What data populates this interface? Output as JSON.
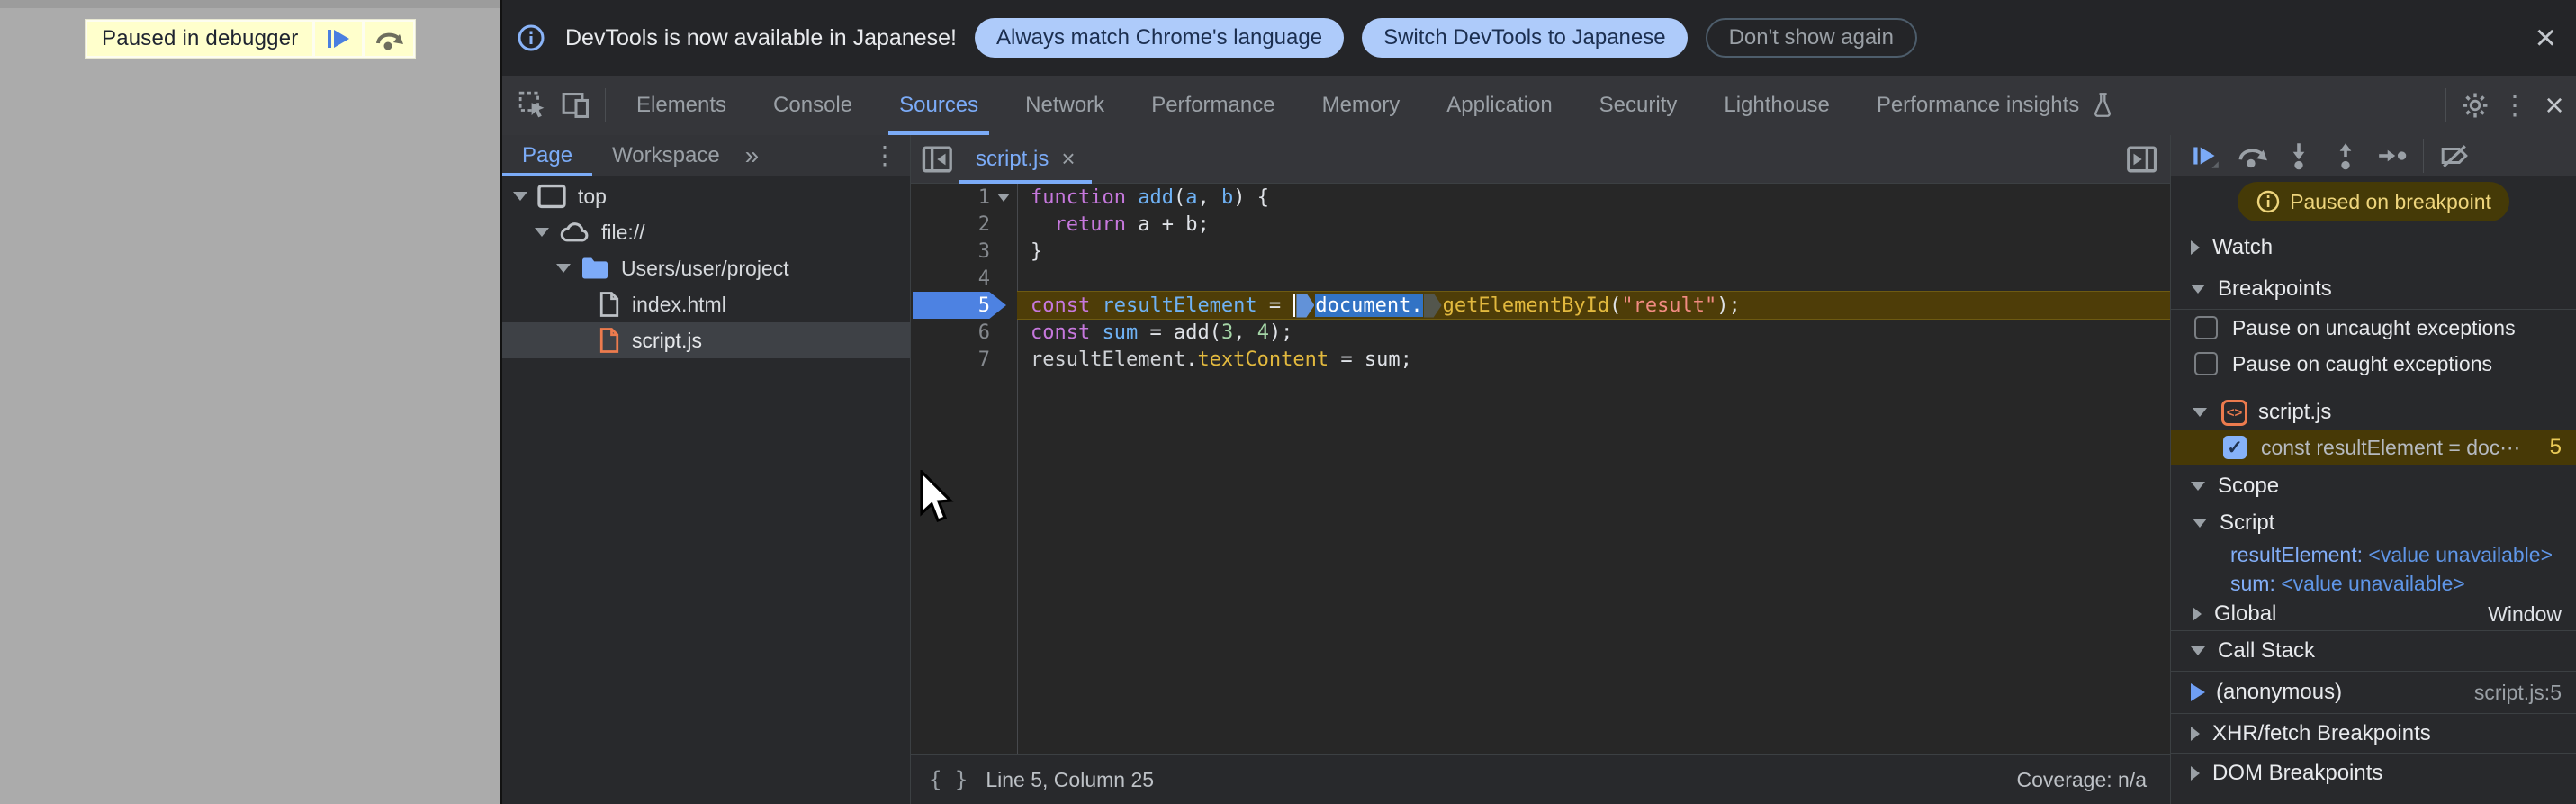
{
  "colors": {
    "accent_blue": "#7babf7",
    "pill_bg": "#aecbfa",
    "pill_text": "#1c2f50",
    "paused_line_bg": "#4e3d08",
    "paused_badge_bg": "#453a07",
    "paused_badge_text": "#eed57c",
    "selection_bg": "#3273c5",
    "keyword": "#c678dd",
    "definition": "#6fb2f5",
    "property": "#e2b93e",
    "string": "#f28b82",
    "number": "#a5d6a7",
    "banner_bg": "#ffffcc",
    "breakpoint_badge": "#4d82e2",
    "folder_icon": "#7dabf8",
    "script_icon_orange": "#ec7b4e"
  },
  "page": {
    "paused_banner_label": "Paused in debugger"
  },
  "infobar": {
    "message": "DevTools is now available in Japanese!",
    "primary_button": "Always match Chrome's language",
    "secondary_button": "Switch DevTools to Japanese",
    "dismiss_button": "Don't show again",
    "close": "×"
  },
  "tabbar": {
    "tabs": [
      "Elements",
      "Console",
      "Sources",
      "Network",
      "Performance",
      "Memory",
      "Application",
      "Security",
      "Lighthouse",
      "Performance insights"
    ],
    "active": "Sources",
    "kebab": "⋮",
    "close": "×"
  },
  "navigator": {
    "tab_page": "Page",
    "tab_workspace": "Workspace",
    "overflow": "»",
    "kebab": "⋮",
    "tree": [
      "top",
      "file://",
      "Users/user/project",
      "index.html",
      "script.js"
    ]
  },
  "editor": {
    "tab_label": "script.js",
    "tab_close": "×",
    "braces_icon": "{ }",
    "status_left": "Line 5, Column 25",
    "status_right": "Coverage: n/a",
    "code": {
      "lines": [
        {
          "num": "1",
          "fold": true,
          "tokens": [
            [
              "kw",
              "function"
            ],
            [
              "fn",
              " add"
            ],
            [
              "pln",
              "("
            ],
            [
              "def",
              "a"
            ],
            [
              "pln",
              ", "
            ],
            [
              "def",
              "b"
            ],
            [
              "pln",
              ") {"
            ]
          ]
        },
        {
          "num": "2",
          "tokens": [
            [
              "pln",
              "  "
            ],
            [
              "kw",
              "return"
            ],
            [
              "pln",
              " a + b;"
            ]
          ]
        },
        {
          "num": "3",
          "tokens": [
            [
              "pln",
              "}"
            ]
          ]
        },
        {
          "num": "4",
          "tokens": []
        },
        {
          "num": "5",
          "active": true,
          "tokens": [
            [
              "kw",
              "const"
            ],
            [
              "def",
              " resultElement"
            ],
            [
              "pln",
              " = "
            ],
            [
              "caret",
              ""
            ],
            [
              "mkblue",
              ""
            ],
            [
              "sel",
              "document."
            ],
            [
              "mkgray",
              ""
            ],
            [
              "prop",
              "getElementById"
            ],
            [
              "pln",
              "("
            ],
            [
              "str",
              "\"result\""
            ],
            [
              "pln",
              ");"
            ]
          ]
        },
        {
          "num": "6",
          "tokens": [
            [
              "kw",
              "const"
            ],
            [
              "def",
              " sum"
            ],
            [
              "pln",
              " = add("
            ],
            [
              "num",
              "3"
            ],
            [
              "pln",
              ", "
            ],
            [
              "num",
              "4"
            ],
            [
              "pln",
              ");"
            ]
          ]
        },
        {
          "num": "7",
          "tokens": [
            [
              "gray",
              "resultElement"
            ],
            [
              "pln",
              "."
            ],
            [
              "prop",
              "textContent"
            ],
            [
              "pln",
              " = sum;"
            ]
          ]
        }
      ]
    }
  },
  "debugger": {
    "paused_badge": "Paused on breakpoint",
    "watch": "Watch",
    "breakpoints": "Breakpoints",
    "pause_uncaught": "Pause on uncaught exceptions",
    "pause_caught": "Pause on caught exceptions",
    "file_group": "script.js",
    "entry_text": "const resultElement = doc⋯",
    "entry_line": "5",
    "scope": "Scope",
    "scope_script": "Script",
    "var1_name": "resultElement: ",
    "var1_value": "<value unavailable>",
    "var2_name": "sum: ",
    "var2_value": "<value unavailable>",
    "global": "Global",
    "global_value": "Window",
    "call_stack": "Call Stack",
    "frame_name": "(anonymous)",
    "frame_location": "script.js:5",
    "xhr": "XHR/fetch Breakpoints",
    "dom": "DOM Breakpoints"
  }
}
